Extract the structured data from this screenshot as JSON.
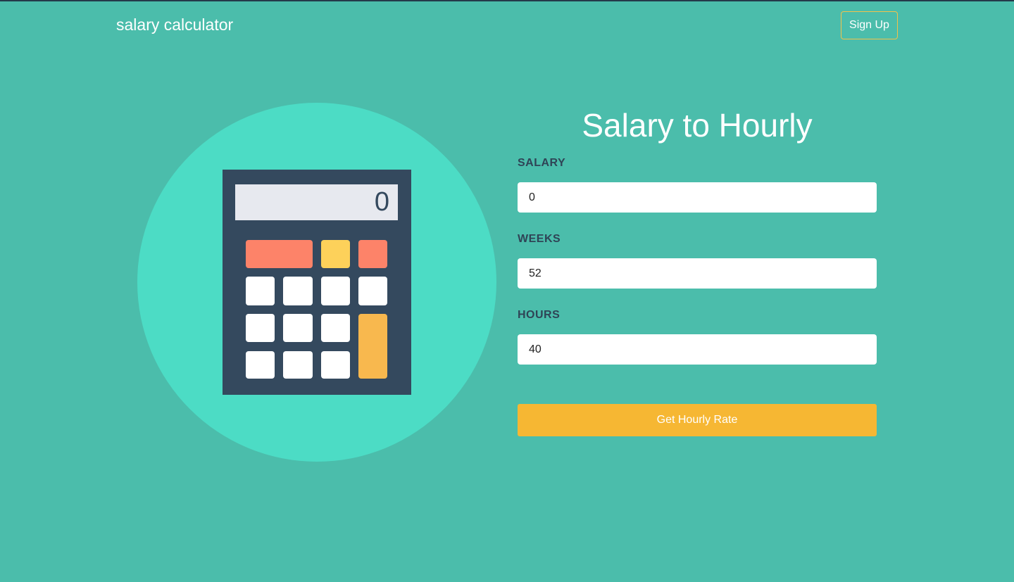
{
  "navbar": {
    "brand": "salary calculator",
    "signup_label": "Sign Up"
  },
  "illustration": {
    "display_value": "0",
    "colors": {
      "circle": "#4cdcc5",
      "body": "#34495e",
      "screen": "#e7e9ef",
      "red_key": "#fd8369",
      "yellow_key": "#fdd15a",
      "orange_key": "#f8b84e"
    }
  },
  "form": {
    "title": "Salary to Hourly",
    "salary": {
      "label": "SALARY",
      "value": "0"
    },
    "weeks": {
      "label": "WEEKS",
      "value": "52"
    },
    "hours": {
      "label": "HOURS",
      "value": "40"
    },
    "submit_label": "Get Hourly Rate"
  },
  "colors": {
    "background": "#4bbdab",
    "accent": "#f6b733",
    "label_text": "#2f4456"
  }
}
